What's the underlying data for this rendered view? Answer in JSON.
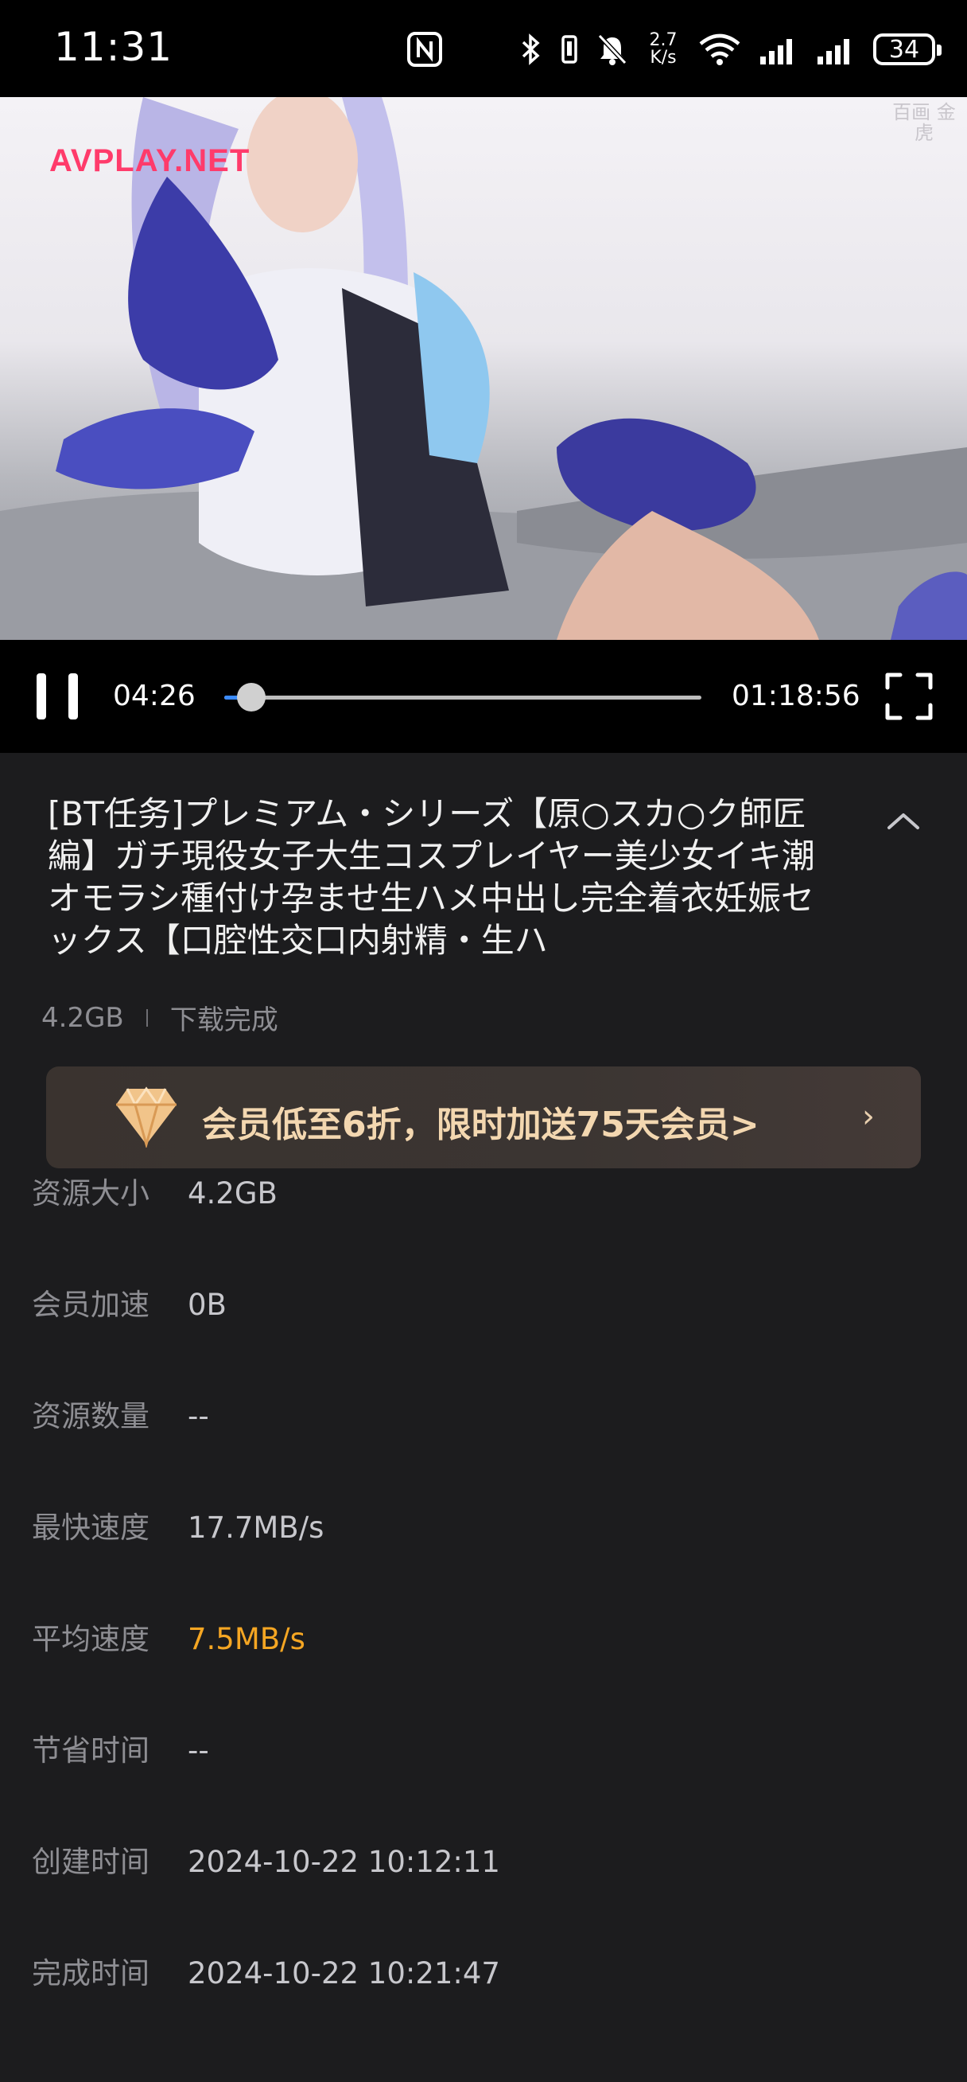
{
  "status_bar": {
    "time": "11:31",
    "network_speed_top": "2.7",
    "network_speed_bottom": "K/s",
    "battery": "34",
    "icons": [
      "nfc-icon",
      "bluetooth-icon",
      "vibrate-icon",
      "mute-icon",
      "wifi-icon",
      "signal-icon",
      "signal-icon",
      "battery-icon"
    ]
  },
  "video": {
    "watermark": "AVPLAY.NET",
    "corner_seal": "百画 金虎"
  },
  "player": {
    "current_time": "04:26",
    "total_time": "01:18:56",
    "progress_fraction": 0.056,
    "progress_color": "#3b8bff",
    "state": "playing"
  },
  "file": {
    "title": "[BT任务]プレミアム・シリーズ【原○スカ○ク師匠編】ガチ現役女子大生コスプレイヤー美少女イキ潮オモラシ種付け孕ませ生ハメ中出し完全着衣妊娠セックス【口腔性交口内射精・生ハ",
    "size": "4.2GB",
    "status": "下载完成"
  },
  "promo": {
    "text": "会员低至6折，限时加送75天会员>",
    "arrow": "›",
    "icon": "diamond-icon"
  },
  "details": [
    {
      "label": "资源大小",
      "value": "4.2GB"
    },
    {
      "label": "会员加速",
      "value": "0B"
    },
    {
      "label": "资源数量",
      "value": "--"
    },
    {
      "label": "最快速度",
      "value": "17.7MB/s"
    },
    {
      "label": "平均速度",
      "value": "7.5MB/s"
    },
    {
      "label": "节省时间",
      "value": "--"
    },
    {
      "label": "创建时间",
      "value": "2024-10-22 10:12:11"
    },
    {
      "label": "完成时间",
      "value": "2024-10-22 10:21:47"
    }
  ],
  "colors": {
    "accent": "#f5a623",
    "background": "#1c1c1e",
    "promo_text": "#f3d7b0"
  }
}
